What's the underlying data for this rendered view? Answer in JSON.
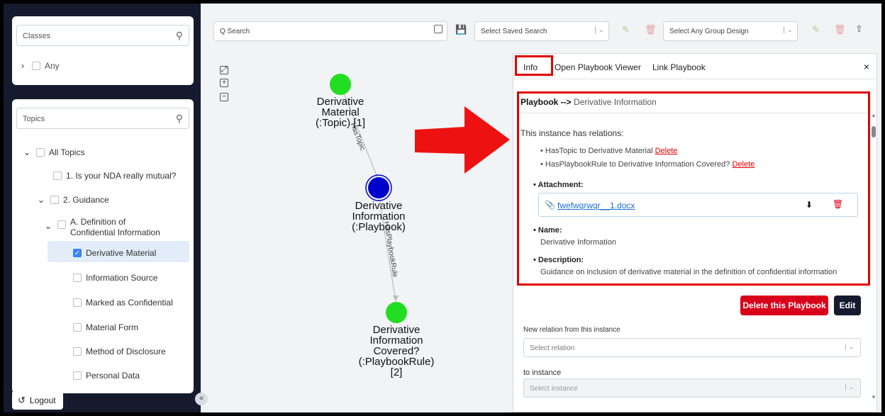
{
  "sidebar": {
    "classes": {
      "placeholder": "Classes",
      "items": [
        {
          "label": "Any"
        }
      ]
    },
    "topics": {
      "placeholder": "Topics",
      "items": [
        {
          "label": "All Topics"
        },
        {
          "label": "1. Is your NDA really mutual?"
        },
        {
          "label": "2. Guidance"
        },
        {
          "label": "A. Definition of Confidential Information"
        },
        {
          "label": "Derivative Material"
        },
        {
          "label": "Information Source"
        },
        {
          "label": "Marked as Confidential"
        },
        {
          "label": "Material Form"
        },
        {
          "label": "Method of Disclosure"
        },
        {
          "label": "Personal Data"
        }
      ]
    },
    "logout_label": "Logout"
  },
  "toolbar": {
    "search_placeholder": "Q Search",
    "saved_search_placeholder": "Select Saved Search",
    "group_design_placeholder": "Select Any Group Design"
  },
  "graph": {
    "nodes": [
      {
        "line1": "Derivative",
        "line2": "Material",
        "line3": "(:Topic)",
        "line4": "[1]",
        "color": "#22dd22"
      },
      {
        "line1": "Derivative",
        "line2": "Information",
        "line3": "(:Playbook)",
        "color": "#0000cc"
      },
      {
        "line1": "Derivative",
        "line2": "Information",
        "line3": "Covered?",
        "line4": "(:PlaybookRule)",
        "line5": "[2]",
        "color": "#22dd22"
      }
    ],
    "edges": [
      {
        "label": "HasTopic"
      },
      {
        "label": "HasPlaybookRule"
      }
    ]
  },
  "info_panel": {
    "tabs": [
      {
        "label": "Info"
      },
      {
        "label": "Open Playbook Viewer"
      },
      {
        "label": "Link Playbook"
      }
    ],
    "close_label": "×",
    "header_type": "Playbook -->",
    "header_name": "Derivative Information",
    "relations_intro": "This instance has relations:",
    "relations": [
      {
        "text": "HasTopic to Derivative Material",
        "action": "Delete"
      },
      {
        "text": "HasPlaybookRule to Derivative Information Covered?",
        "action": "Delete"
      }
    ],
    "attachment_label": "Attachment:",
    "attachment_file": "fwefwqrwqr__1.docx",
    "name_label": "Name:",
    "name_value": "Derivative Information",
    "description_label": "Description:",
    "description_value": "Guidance on inclusion of derivative material in the definition of confidential information",
    "delete_button": "Delete this Playbook",
    "edit_button": "Edit",
    "new_relation_label": "New relation from this instance",
    "select_relation_placeholder": "Select relation",
    "to_instance_label": "to instance",
    "select_instance_placeholder": "Select instance"
  },
  "colors": {
    "highlight": "#e00000",
    "arrow": "#ee1111",
    "sidebar_bg": "#161a2e",
    "danger": "#d9001b"
  }
}
